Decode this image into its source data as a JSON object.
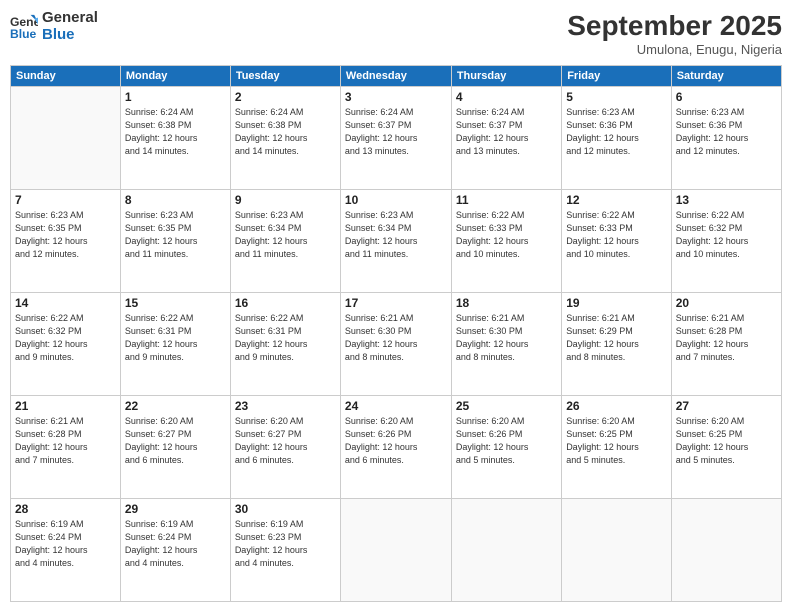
{
  "logo": {
    "line1": "General",
    "line2": "Blue"
  },
  "header": {
    "title": "September 2025",
    "location": "Umulona, Enugu, Nigeria"
  },
  "days_of_week": [
    "Sunday",
    "Monday",
    "Tuesday",
    "Wednesday",
    "Thursday",
    "Friday",
    "Saturday"
  ],
  "weeks": [
    [
      {
        "day": "",
        "info": ""
      },
      {
        "day": "1",
        "info": "Sunrise: 6:24 AM\nSunset: 6:38 PM\nDaylight: 12 hours\nand 14 minutes."
      },
      {
        "day": "2",
        "info": "Sunrise: 6:24 AM\nSunset: 6:38 PM\nDaylight: 12 hours\nand 14 minutes."
      },
      {
        "day": "3",
        "info": "Sunrise: 6:24 AM\nSunset: 6:37 PM\nDaylight: 12 hours\nand 13 minutes."
      },
      {
        "day": "4",
        "info": "Sunrise: 6:24 AM\nSunset: 6:37 PM\nDaylight: 12 hours\nand 13 minutes."
      },
      {
        "day": "5",
        "info": "Sunrise: 6:23 AM\nSunset: 6:36 PM\nDaylight: 12 hours\nand 12 minutes."
      },
      {
        "day": "6",
        "info": "Sunrise: 6:23 AM\nSunset: 6:36 PM\nDaylight: 12 hours\nand 12 minutes."
      }
    ],
    [
      {
        "day": "7",
        "info": "Sunrise: 6:23 AM\nSunset: 6:35 PM\nDaylight: 12 hours\nand 12 minutes."
      },
      {
        "day": "8",
        "info": "Sunrise: 6:23 AM\nSunset: 6:35 PM\nDaylight: 12 hours\nand 11 minutes."
      },
      {
        "day": "9",
        "info": "Sunrise: 6:23 AM\nSunset: 6:34 PM\nDaylight: 12 hours\nand 11 minutes."
      },
      {
        "day": "10",
        "info": "Sunrise: 6:23 AM\nSunset: 6:34 PM\nDaylight: 12 hours\nand 11 minutes."
      },
      {
        "day": "11",
        "info": "Sunrise: 6:22 AM\nSunset: 6:33 PM\nDaylight: 12 hours\nand 10 minutes."
      },
      {
        "day": "12",
        "info": "Sunrise: 6:22 AM\nSunset: 6:33 PM\nDaylight: 12 hours\nand 10 minutes."
      },
      {
        "day": "13",
        "info": "Sunrise: 6:22 AM\nSunset: 6:32 PM\nDaylight: 12 hours\nand 10 minutes."
      }
    ],
    [
      {
        "day": "14",
        "info": "Sunrise: 6:22 AM\nSunset: 6:32 PM\nDaylight: 12 hours\nand 9 minutes."
      },
      {
        "day": "15",
        "info": "Sunrise: 6:22 AM\nSunset: 6:31 PM\nDaylight: 12 hours\nand 9 minutes."
      },
      {
        "day": "16",
        "info": "Sunrise: 6:22 AM\nSunset: 6:31 PM\nDaylight: 12 hours\nand 9 minutes."
      },
      {
        "day": "17",
        "info": "Sunrise: 6:21 AM\nSunset: 6:30 PM\nDaylight: 12 hours\nand 8 minutes."
      },
      {
        "day": "18",
        "info": "Sunrise: 6:21 AM\nSunset: 6:30 PM\nDaylight: 12 hours\nand 8 minutes."
      },
      {
        "day": "19",
        "info": "Sunrise: 6:21 AM\nSunset: 6:29 PM\nDaylight: 12 hours\nand 8 minutes."
      },
      {
        "day": "20",
        "info": "Sunrise: 6:21 AM\nSunset: 6:28 PM\nDaylight: 12 hours\nand 7 minutes."
      }
    ],
    [
      {
        "day": "21",
        "info": "Sunrise: 6:21 AM\nSunset: 6:28 PM\nDaylight: 12 hours\nand 7 minutes."
      },
      {
        "day": "22",
        "info": "Sunrise: 6:20 AM\nSunset: 6:27 PM\nDaylight: 12 hours\nand 6 minutes."
      },
      {
        "day": "23",
        "info": "Sunrise: 6:20 AM\nSunset: 6:27 PM\nDaylight: 12 hours\nand 6 minutes."
      },
      {
        "day": "24",
        "info": "Sunrise: 6:20 AM\nSunset: 6:26 PM\nDaylight: 12 hours\nand 6 minutes."
      },
      {
        "day": "25",
        "info": "Sunrise: 6:20 AM\nSunset: 6:26 PM\nDaylight: 12 hours\nand 5 minutes."
      },
      {
        "day": "26",
        "info": "Sunrise: 6:20 AM\nSunset: 6:25 PM\nDaylight: 12 hours\nand 5 minutes."
      },
      {
        "day": "27",
        "info": "Sunrise: 6:20 AM\nSunset: 6:25 PM\nDaylight: 12 hours\nand 5 minutes."
      }
    ],
    [
      {
        "day": "28",
        "info": "Sunrise: 6:19 AM\nSunset: 6:24 PM\nDaylight: 12 hours\nand 4 minutes."
      },
      {
        "day": "29",
        "info": "Sunrise: 6:19 AM\nSunset: 6:24 PM\nDaylight: 12 hours\nand 4 minutes."
      },
      {
        "day": "30",
        "info": "Sunrise: 6:19 AM\nSunset: 6:23 PM\nDaylight: 12 hours\nand 4 minutes."
      },
      {
        "day": "",
        "info": ""
      },
      {
        "day": "",
        "info": ""
      },
      {
        "day": "",
        "info": ""
      },
      {
        "day": "",
        "info": ""
      }
    ]
  ]
}
